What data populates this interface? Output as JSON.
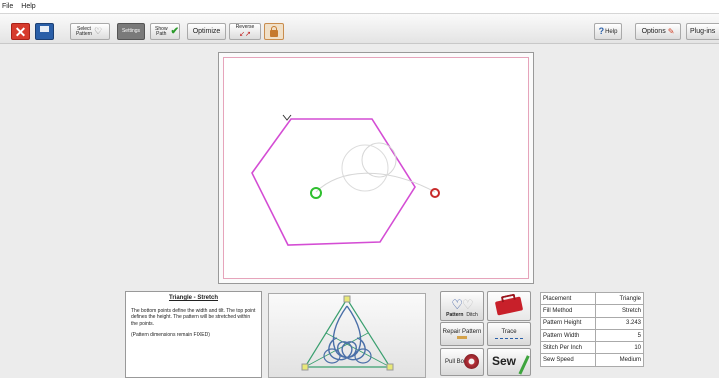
{
  "menu": {
    "file": "File",
    "help": "Help"
  },
  "toolbar": {
    "select_pattern": "Select Pattern",
    "settings": "Settings",
    "show_path": "Show Path",
    "optimize": "Optimize",
    "reverse": "Reverse",
    "help": "Help",
    "options": "Options",
    "plugins": "Plug-ins"
  },
  "description": {
    "title": "Triangle - Stretch",
    "paragraph1": "The bottom points define the width and tilt. The top point defines the height. The pattern will be stretched within the points.",
    "paragraph2": "(Pattern dimensions remain FIXED)"
  },
  "controls": {
    "pattern": "Pattern",
    "ditch": "Ditch",
    "repair_pattern": "Repair Pattern",
    "trace": "Trace",
    "pull_bobbin": "Pull Bobbin",
    "sew": "Sew"
  },
  "properties": [
    {
      "key": "Placement",
      "value": "Triangle"
    },
    {
      "key": "Fill Method",
      "value": "Stretch"
    },
    {
      "key": "Pattern Height",
      "value": "3.243"
    },
    {
      "key": "Pattern Width",
      "value": "5"
    },
    {
      "key": "Stitch Per Inch",
      "value": "10"
    },
    {
      "key": "Sew Speed",
      "value": "Medium"
    }
  ],
  "colors": {
    "boundary": "#d44dd4",
    "start_point": "#2fbf2f",
    "end_point": "#c82a2a",
    "preview_triangle": "#3a9f6f",
    "preview_pattern": "#4a6fa8"
  }
}
